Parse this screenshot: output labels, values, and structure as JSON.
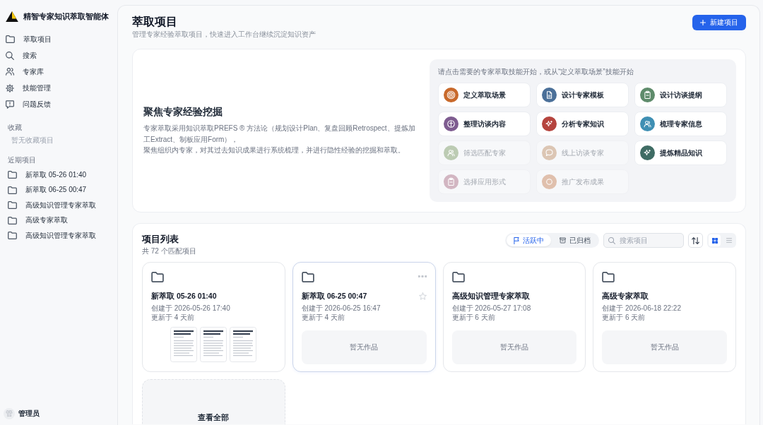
{
  "sidebar": {
    "app_title": "精智专家知识萃取智能体",
    "nav_items": [
      {
        "label": "萃取项目",
        "selected": false
      },
      {
        "label": "搜索",
        "selected": false
      },
      {
        "label": "专家库",
        "selected": false
      },
      {
        "label": "技能管理",
        "selected": false
      },
      {
        "label": "问题反馈",
        "selected": false
      }
    ],
    "favorites": {
      "heading": "收藏",
      "empty_text": "暂无收藏项目"
    },
    "recent": {
      "heading": "近期项目",
      "items": [
        "新萃取 05-26 01:40",
        "新萃取 06-25 00:47",
        "高级知识管理专家萃取",
        "高级专家萃取",
        "高级知识管理专家萃取"
      ]
    },
    "user": {
      "avatar_text": "管",
      "name": "管理员"
    }
  },
  "header": {
    "title": "萃取项目",
    "subtitle": "管理专家经验萃取项目，快速进入工作台继续沉淀知识资产",
    "new_button": "新建项目"
  },
  "hero": {
    "title": "聚焦专家经验挖掘",
    "paragraphs": [
      "专家萃取采用知识萃取PREFS ® 方法论（规划设计Plan、复盘回顾Retrospect、提炼加工Extract、制板应用Form），",
      "聚焦组织内专家，对其过去知识成果进行系统梳理，并进行隐性经验的挖掘和萃取。"
    ]
  },
  "skills": {
    "hint": "请点击需要的专家萃取技能开始，或从“定义萃取场景”技能开始",
    "items": [
      {
        "label": "定义萃取场景",
        "color": "#c8692b",
        "disabled": false
      },
      {
        "label": "设计专家模板",
        "color": "#4b7099",
        "disabled": false
      },
      {
        "label": "设计访谈提纲",
        "color": "#5e8b6b",
        "disabled": false
      },
      {
        "label": "整理访谈内容",
        "color": "#7e5c90",
        "disabled": false
      },
      {
        "label": "分析专家知识",
        "color": "#b5443e",
        "disabled": false
      },
      {
        "label": "梳理专家信息",
        "color": "#3f8fb3",
        "disabled": false
      },
      {
        "label": "筛选匹配专家",
        "color": "#bccbb3",
        "disabled": true
      },
      {
        "label": "线上访谈专家",
        "color": "#dcc6b4",
        "disabled": true
      },
      {
        "label": "提炼精品知识",
        "color": "#3f6c64",
        "disabled": false
      },
      {
        "label": "选择应用形式",
        "color": "#d2b6c2",
        "disabled": true
      },
      {
        "label": "推广发布成果",
        "color": "#e0c0ad",
        "disabled": true
      }
    ]
  },
  "projects": {
    "title": "项目列表",
    "count": "共 72 个匹配项目",
    "filters": [
      {
        "label": "活跃中",
        "selected": true
      },
      {
        "label": "已归档",
        "selected": false
      }
    ],
    "search": {
      "placeholder": "搜索项目"
    },
    "views": [
      {
        "kind": "grid",
        "selected": true
      },
      {
        "kind": "list",
        "selected": false
      }
    ],
    "cards": [
      {
        "title": "新萃取 05-26 01:40",
        "created": "创建于 2026-05-26 17:40",
        "updated": "更新于 4 天前",
        "hovered": false,
        "works": {
          "kind": "documents",
          "items": [
            {
              "kind": "document"
            },
            {
              "kind": "document"
            },
            {
              "kind": "document"
            }
          ]
        }
      },
      {
        "title": "新萃取 06-25 00:47",
        "created": "创建于 2026-06-25 16:47",
        "updated": "更新于 4 天前",
        "hovered": true,
        "works": {
          "kind": "empty",
          "text": "暂无作品"
        }
      },
      {
        "title": "高级知识管理专家萃取",
        "created": "创建于 2026-05-27 17:08",
        "updated": "更新于 6 天前",
        "hovered": false,
        "works": {
          "kind": "empty",
          "text": "暂无作品"
        }
      },
      {
        "title": "高级专家萃取",
        "created": "创建于 2026-06-18 22:22",
        "updated": "更新于 6 天前",
        "hovered": false,
        "works": {
          "kind": "empty",
          "text": "暂无作品"
        }
      }
    ],
    "view_all": "查看全部"
  }
}
